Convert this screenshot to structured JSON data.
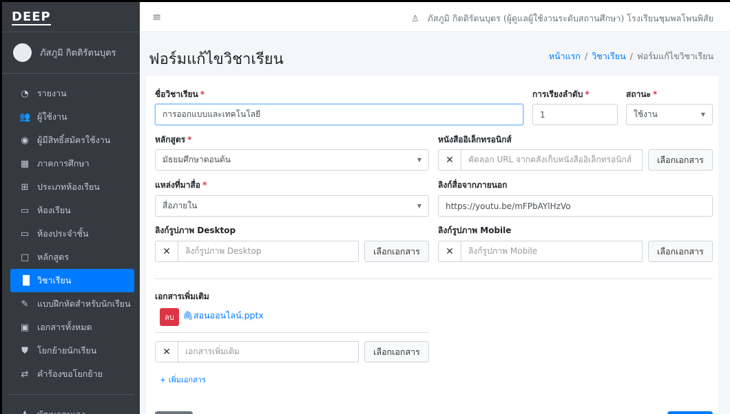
{
  "brand": {
    "logo": "DEEP"
  },
  "user": {
    "name": "ภัสภูมิ กิตติรัตนบุตร"
  },
  "topbar": {
    "user_info": "ภัสภูมิ กิตติรัตนบุตร (ผู้ดูแลผู้ใช้งานระดับสถานศึกษา) โรงเรียนชุมพลโพนพิสัย"
  },
  "sidebar": {
    "items": [
      {
        "label": "รายงาน",
        "icon": "tachometer-icon",
        "glyph": "◔"
      },
      {
        "label": "ผู้ใช้งาน",
        "icon": "users-icon",
        "glyph": "👥"
      },
      {
        "label": "ผู้มีสิทธิ์สมัครใช้งาน",
        "icon": "user-circle-icon",
        "glyph": "◉"
      },
      {
        "label": "ภาคการศึกษา",
        "icon": "calendar-icon",
        "glyph": "▦"
      },
      {
        "label": "ประเภทห้องเรียน",
        "icon": "table-icon",
        "glyph": "⊞"
      },
      {
        "label": "ห้องเรียน",
        "icon": "chalkboard-icon",
        "glyph": "▭"
      },
      {
        "label": "ห้องประจำชั้น",
        "icon": "chalkboard-teacher-icon",
        "glyph": "▭"
      },
      {
        "label": "หลักสูตร",
        "icon": "window-icon",
        "glyph": "□"
      },
      {
        "label": "วิชาเรียน",
        "icon": "book-open-icon",
        "glyph": "▐▌"
      },
      {
        "label": "แบบฝึกหัดสำหรับนักเรียน",
        "icon": "edit-icon",
        "glyph": "✎"
      },
      {
        "label": "เอกสารทั้งหมด",
        "icon": "file-icon",
        "glyph": "▣"
      },
      {
        "label": "โยกย้ายนักเรียน",
        "icon": "user-move-icon",
        "glyph": "⛊"
      },
      {
        "label": "คำร้องขอโยกย้าย",
        "icon": "exchange-icon",
        "glyph": "⇄"
      }
    ],
    "active_index": 8,
    "bottom_item": {
      "label": "พัฒนาตนเอง",
      "icon": "person-icon",
      "glyph": "♟"
    }
  },
  "header": {
    "title": "ฟอร์มแก้ไขวิชาเรียน",
    "breadcrumb": [
      "หน้าแรก",
      "วิชาเรียน",
      "ฟอร์มแก้ไขวิชาเรียน"
    ]
  },
  "form": {
    "subject_name": {
      "label": "ชื่อวิชาเรียน",
      "value": "การออกแบบและเทคโนโลยี"
    },
    "order": {
      "label": "การเรียงลำดับ",
      "value": "1"
    },
    "status": {
      "label": "สถานะ",
      "value": "ใช้งาน"
    },
    "curriculum": {
      "label": "หลักสูตร",
      "value": "มัธยมศึกษาตอนต้น"
    },
    "ebook": {
      "label": "หนังสืออิเล็กทรอนิกส์",
      "placeholder": "คัดลอก URL จากคลังเก็บหนังสืออิเล็กทรอนิกส์",
      "button": "เลือกเอกสาร"
    },
    "media_source": {
      "label": "แหล่งที่มาสื่อ",
      "value": "สื่อภายใน"
    },
    "external_link": {
      "label": "ลิงก์สื่อจากภายนอก",
      "value": "https://youtu.be/mFPbAYlHzVo"
    },
    "desktop_image": {
      "label": "ลิงก์รูปภาพ Desktop",
      "placeholder": "ลิงก์รูปภาพ Desktop",
      "button": "เลือกเอกสาร"
    },
    "mobile_image": {
      "label": "ลิงก์รูปภาพ Mobile",
      "placeholder": "ลิงก์รูปภาพ Mobile",
      "button": "เลือกเอกสาร"
    },
    "extra_docs": {
      "label": "เอกสารเพิ่มเติม",
      "delete_label": "ลบ",
      "file_name": "สอนออนไลน์.pptx",
      "placeholder": "เอกสารเพิ่มเติม",
      "button": "เลือกเอกสาร",
      "add_label": "+ เพิ่มเอกสาร"
    }
  },
  "colors": {
    "primary": "#007bff",
    "danger": "#dc3545",
    "sidebar": "#343a40"
  }
}
